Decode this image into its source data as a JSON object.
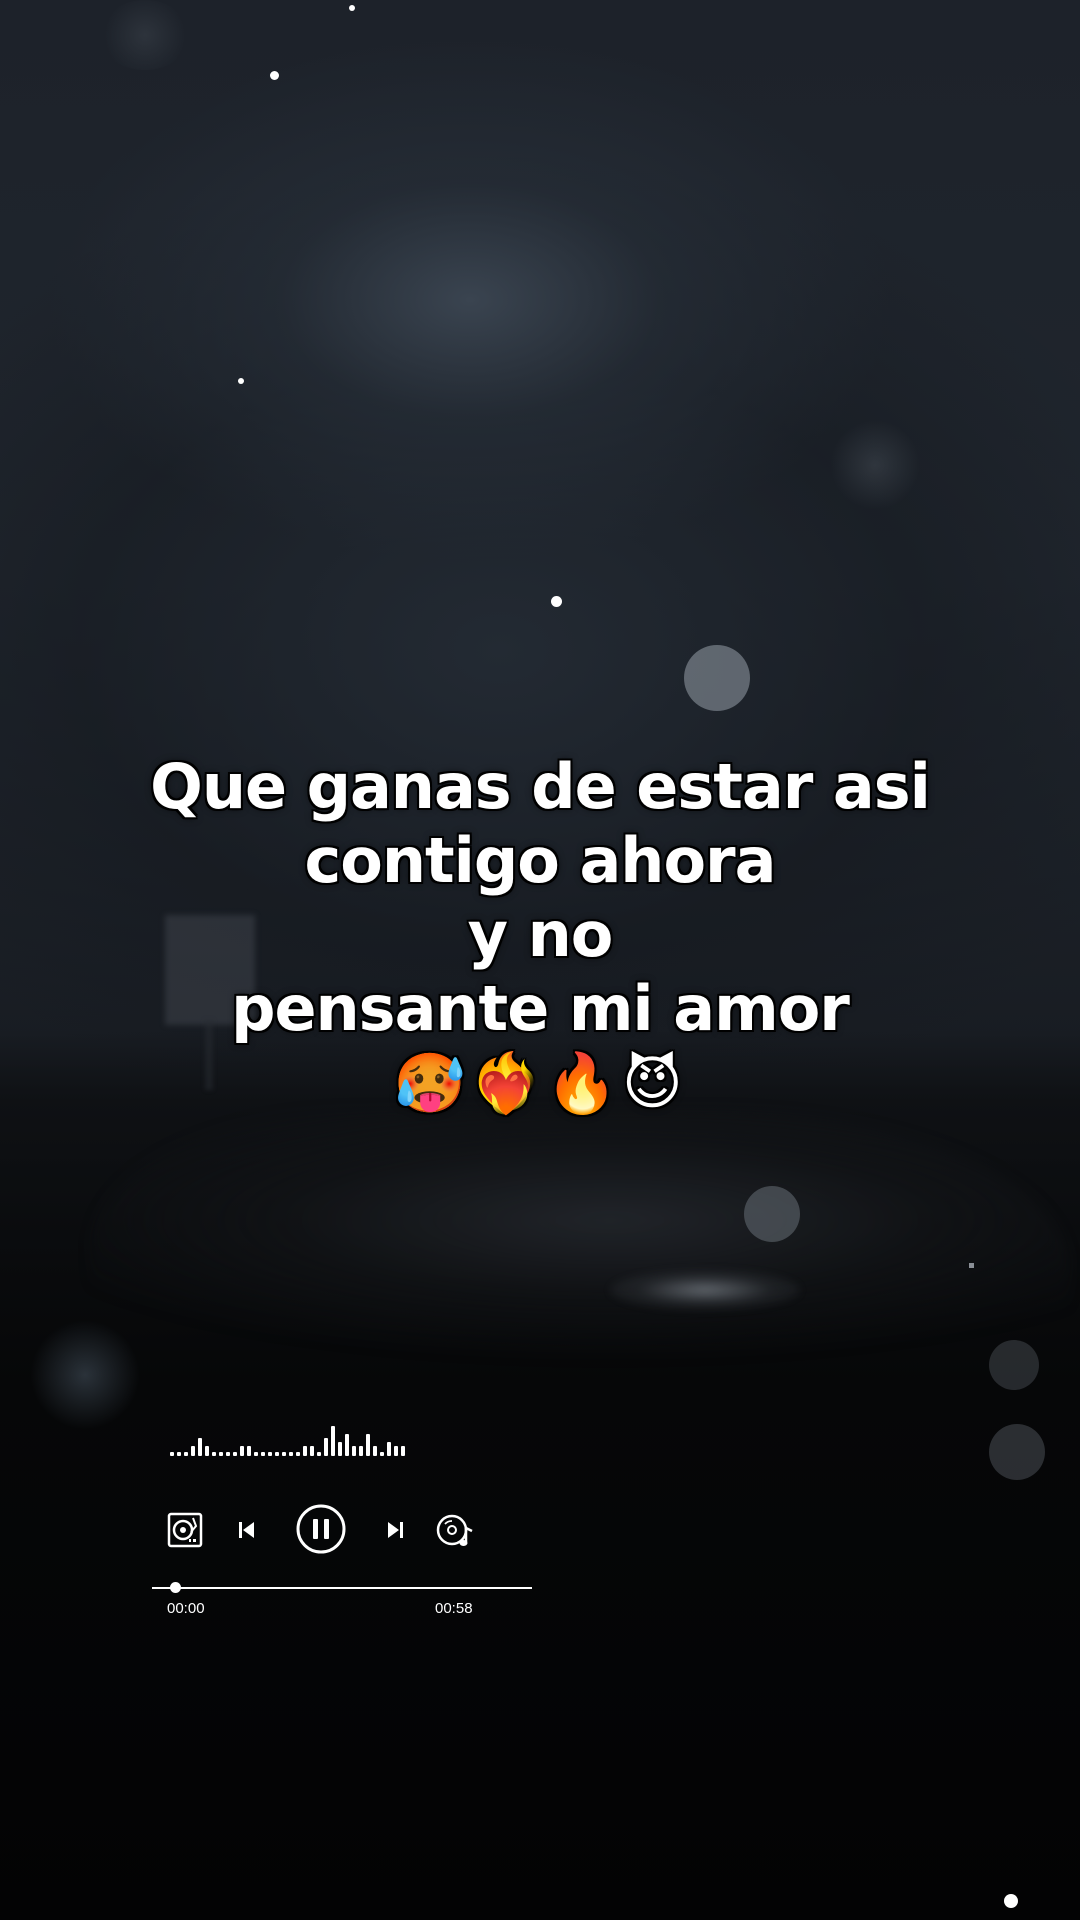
{
  "lyrics": {
    "line1": "Que ganas de estar asi",
    "line2": "contigo ahora",
    "line3": "y no",
    "line4": "pensante mi amor",
    "emojis": "🥵❤️‍🔥🔥😈"
  },
  "player": {
    "time_elapsed": "00:00",
    "time_total": "00:58",
    "progress": 0.06,
    "state": "playing",
    "icons": {
      "left": "turntable-icon",
      "prev": "skip-previous-icon",
      "play_pause": "pause-icon",
      "next": "skip-next-icon",
      "right": "music-disc-icon"
    }
  },
  "colors": {
    "text": "#ffffff",
    "background": "#1d222a",
    "text_outline": "#000000"
  }
}
